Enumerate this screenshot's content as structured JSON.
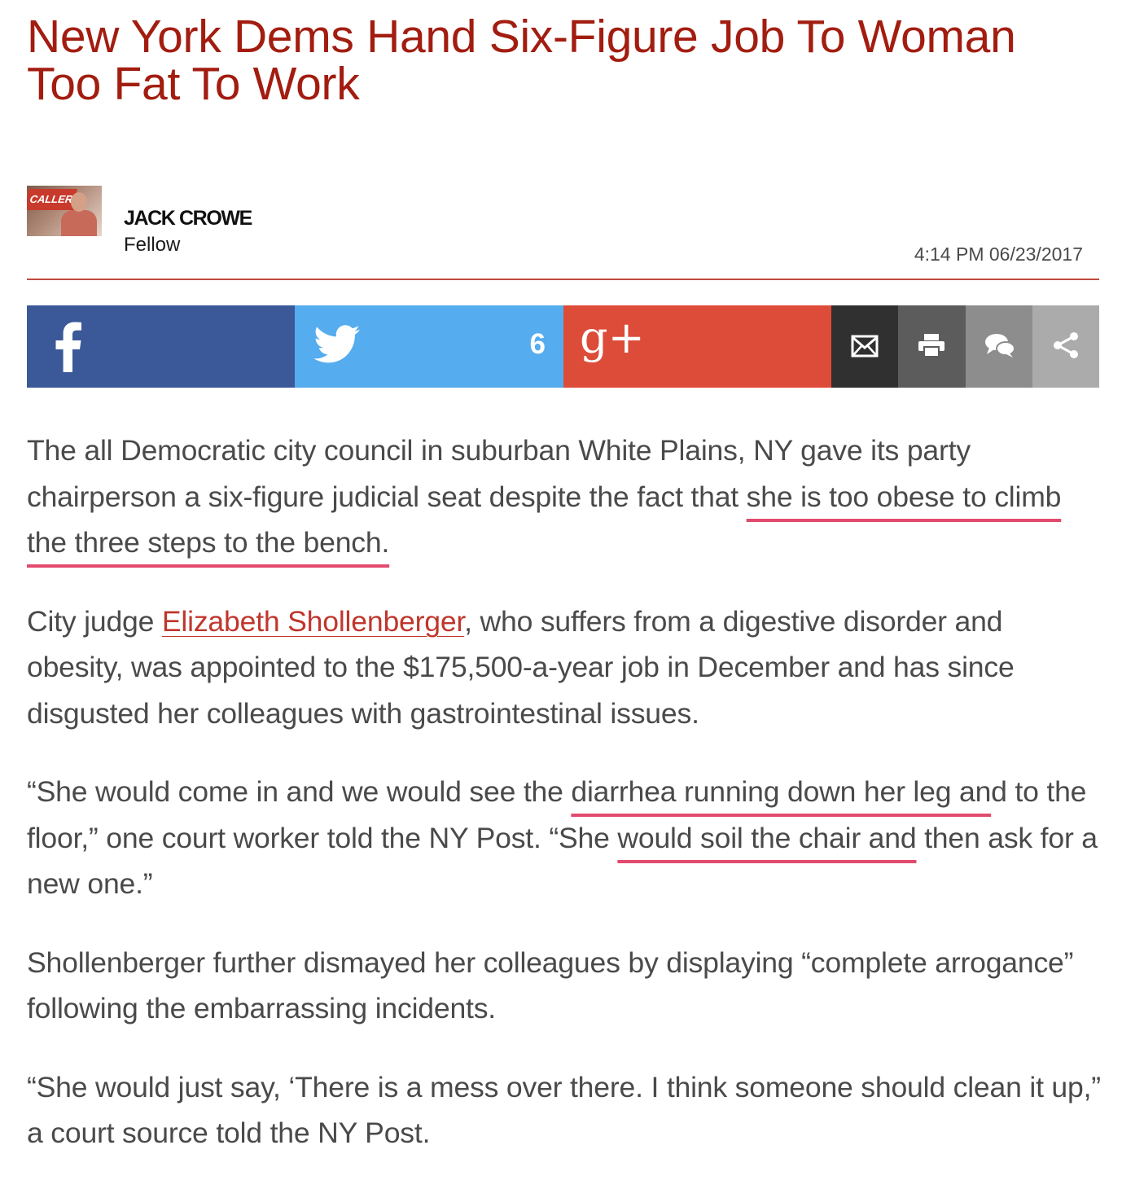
{
  "article": {
    "title": "New York Dems Hand Six-Figure Job To Woman Too Fat To Work",
    "author": {
      "name": "JACK CROWE",
      "role": "Fellow",
      "avatar_sign_text": "CALLER"
    },
    "timestamp": "4:14 PM 06/23/2017",
    "share": {
      "facebook_icon": "facebook-icon",
      "twitter_icon": "twitter-icon",
      "twitter_count": "6",
      "gplus_label": "g+",
      "email_icon": "envelope-icon",
      "print_icon": "printer-icon",
      "comment_icon": "comments-icon",
      "more_icon": "share-icon"
    },
    "paragraphs": [
      {
        "p1_a": "The all Democratic city council in suburban White Plains, NY gave its party chairperson a six-figure judicial seat despite the fact that ",
        "p1_hl": "she is too obese to climb the three steps to the bench.",
        "p1_b": " "
      },
      {
        "p2_a": "City judge ",
        "p2_link": "Elizabeth Shollenberger",
        "p2_b": ", who suffers from a digestive disorder and obesity, was appointed to the $175,500-a-year job in December and has since disgusted her colleagues with gastrointestinal issues."
      },
      {
        "p3_a": "“She would come in and we would see the ",
        "p3_hl1": "diarrhea running down her leg an",
        "p3_b": "d to the floor,” one court worker told the NY Post. “She ",
        "p3_hl2": "would soil the chair and",
        "p3_c": " then ask for a new one.”"
      },
      {
        "p4": "Shollenberger further dismayed her colleagues by displaying “complete arrogance” following the embarrassing incidents."
      },
      {
        "p5": "“She would just say, ‘There is a mess over there. I think someone should clean it up,” a court source told the NY Post."
      }
    ]
  },
  "colors": {
    "title": "#a21d10",
    "facebook": "#3b5998",
    "twitter": "#55acee",
    "gplus": "#dd4b39",
    "highlight_underline": "#e24a6e",
    "link": "#c0362c"
  }
}
